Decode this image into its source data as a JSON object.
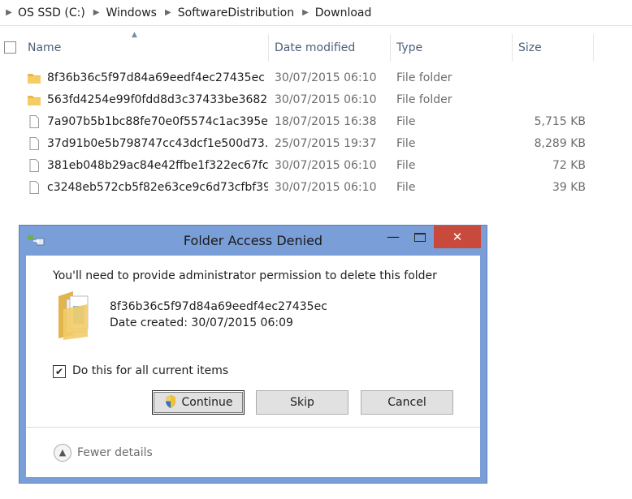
{
  "breadcrumb": [
    "OS SSD (C:)",
    "Windows",
    "SoftwareDistribution",
    "Download"
  ],
  "columns": {
    "name": "Name",
    "date": "Date modified",
    "type": "Type",
    "size": "Size"
  },
  "files": [
    {
      "icon": "folder-icon",
      "name": "8f36b36c5f97d84a69eedf4ec27435ec",
      "date": "30/07/2015 06:10",
      "type": "File folder",
      "size": ""
    },
    {
      "icon": "folder-icon",
      "name": "563fd4254e99f0fdd8d3c37433be3682",
      "date": "30/07/2015 06:10",
      "type": "File folder",
      "size": ""
    },
    {
      "icon": "file-icon",
      "name": "7a907b5b1bc88fe70e0f5574c1ac395e...",
      "date": "18/07/2015 16:38",
      "type": "File",
      "size": "5,715 KB"
    },
    {
      "icon": "file-icon",
      "name": "37d91b0e5b798747cc43dcf1e500d73...",
      "date": "25/07/2015 19:37",
      "type": "File",
      "size": "8,289 KB"
    },
    {
      "icon": "file-icon",
      "name": "381eb048b29ac84e42ffbe1f322ec67fc...",
      "date": "30/07/2015 06:10",
      "type": "File",
      "size": "72 KB"
    },
    {
      "icon": "file-icon",
      "name": "c3248eb572cb5f82e63ce9c6d73cfbf39...",
      "date": "30/07/2015 06:10",
      "type": "File",
      "size": "39 KB"
    }
  ],
  "dialog": {
    "title": "Folder Access Denied",
    "message": "You'll need to provide administrator permission to delete this folder",
    "folder_name": "8f36b36c5f97d84a69eedf4ec27435ec",
    "date_created": "Date created: 30/07/2015 06:09",
    "checkbox_label": "Do this for all current items",
    "checkbox_checked": true,
    "buttons": {
      "continue": "Continue",
      "skip": "Skip",
      "cancel": "Cancel"
    },
    "details_toggle": "Fewer details"
  },
  "colors": {
    "titlebar": "#7a9fd8",
    "close": "#c84a3d",
    "header_text": "#4c607a",
    "folder": "#e8b84a"
  }
}
